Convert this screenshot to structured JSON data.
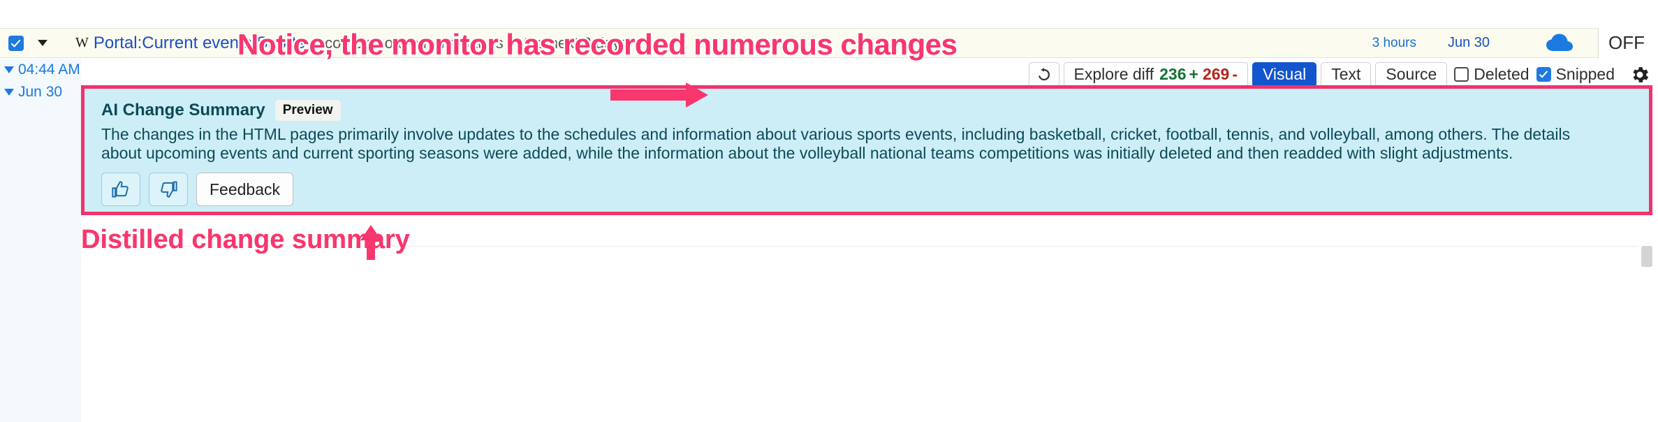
{
  "top_row": {
    "checkbox_checked": true,
    "dropdown_icon": "chevron-down-icon",
    "site_icon": "wikipedia-w-icon",
    "page_title": "Portal:Current events/Sports",
    "title_separator": "-",
    "title_snippet": "... comp r  t  o o o  n  u o  s  tt   r  s   in the next 2 days",
    "relative_time": "3 hours",
    "date": "Jun 30",
    "cloud_icon": "cloud-icon",
    "off_label": "OFF"
  },
  "rail": {
    "items": [
      {
        "label": "04:44 AM"
      },
      {
        "label": "Jun 30"
      }
    ]
  },
  "toolbar": {
    "history_icon": "history-rewind-icon",
    "explore_diff_label": "Explore diff",
    "additions": "236",
    "plus_sign": "+",
    "deletions": "269",
    "minus_sign": "-",
    "view_modes": [
      {
        "label": "Visual",
        "active": true
      },
      {
        "label": "Text",
        "active": false
      },
      {
        "label": "Source",
        "active": false
      }
    ],
    "deleted_label": "Deleted",
    "deleted_checked": false,
    "snipped_label": "Snipped",
    "snipped_checked": true,
    "settings_icon": "gear-icon"
  },
  "ai_summary": {
    "title": "AI Change Summary",
    "badge": "Preview",
    "body": "The changes in the HTML pages primarily involve updates to the schedules and information about various sports events, including basketball, cricket, football, tennis, and volleyball, among others. The details about upcoming events and current sporting seasons were added, while the information about the volleyball national teams competitions was initially deleted and then readded with slight adjustments.",
    "thumbs_up_icon": "thumbs-up-icon",
    "thumbs_down_icon": "thumbs-down-icon",
    "feedback_label": "Feedback"
  },
  "annotations": {
    "headline": "Notice, the monitor has recorded numerous changes",
    "caption": "Distilled change summary",
    "accent_color": "#f8376f",
    "arrow_up_icon": "arrow-up-icon",
    "arrow_left_icon": "arrow-left-icon"
  },
  "colors": {
    "accent_pink": "#f8376f",
    "summary_bg": "#cdeef7",
    "summary_text": "#0d4a58",
    "link_blue": "#1a4fc4",
    "active_blue": "#1355cc",
    "add_green": "#137333",
    "del_red": "#b3261e",
    "top_bar_bg": "#fbfbef"
  }
}
